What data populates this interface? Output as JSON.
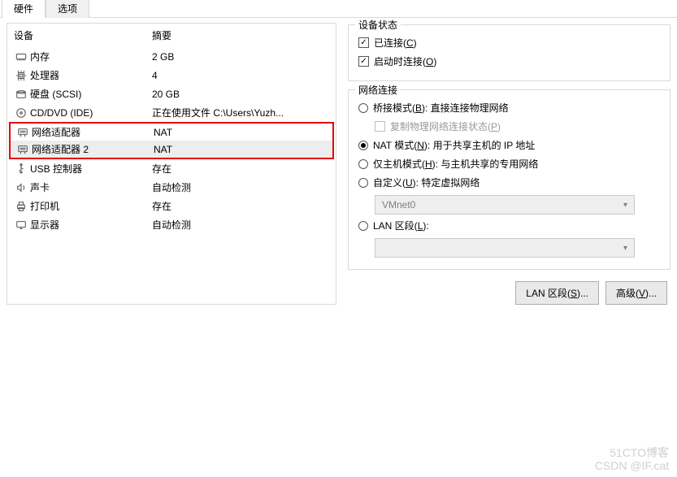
{
  "tabs": {
    "hardware": "硬件",
    "options": "选项"
  },
  "columns": {
    "device": "设备",
    "summary": "摘要"
  },
  "devices": [
    {
      "icon": "memory-icon",
      "name": "内存",
      "summary": "2 GB"
    },
    {
      "icon": "cpu-icon",
      "name": "处理器",
      "summary": "4"
    },
    {
      "icon": "disk-icon",
      "name": "硬盘 (SCSI)",
      "summary": "20 GB"
    },
    {
      "icon": "cd-icon",
      "name": "CD/DVD (IDE)",
      "summary": "正在使用文件 C:\\Users\\Yuzh..."
    },
    {
      "icon": "nic-icon",
      "name": "网络适配器",
      "summary": "NAT"
    },
    {
      "icon": "nic-icon",
      "name": "网络适配器 2",
      "summary": "NAT"
    },
    {
      "icon": "usb-icon",
      "name": "USB 控制器",
      "summary": "存在"
    },
    {
      "icon": "sound-icon",
      "name": "声卡",
      "summary": "自动检测"
    },
    {
      "icon": "printer-icon",
      "name": "打印机",
      "summary": "存在"
    },
    {
      "icon": "display-icon",
      "name": "显示器",
      "summary": "自动检测"
    }
  ],
  "highlight_rows": [
    4,
    5
  ],
  "selected_row": 5,
  "status_group": {
    "title": "设备状态",
    "connected": {
      "label": "已连接(",
      "key": "C",
      "tail": ")",
      "checked": true
    },
    "connect_on": {
      "label": "启动时连接(",
      "key": "O",
      "tail": ")",
      "checked": true
    }
  },
  "net_group": {
    "title": "网络连接",
    "bridge": {
      "label": "桥接模式(",
      "key": "B",
      "tail": "): 直接连接物理网络"
    },
    "bridge_sub": {
      "label": "复制物理网络连接状态(",
      "key": "P",
      "tail": ")"
    },
    "nat": {
      "label": "NAT 模式(",
      "key": "N",
      "tail": "): 用于共享主机的 IP 地址"
    },
    "hostonly": {
      "label": "仅主机模式(",
      "key": "H",
      "tail": "): 与主机共享的专用网络"
    },
    "custom": {
      "label": "自定义(",
      "key": "U",
      "tail": "): 特定虚拟网络"
    },
    "custom_combo": "VMnet0",
    "lan": {
      "label": "LAN 区段(",
      "key": "L",
      "tail": "):"
    },
    "lan_combo": ""
  },
  "buttons": {
    "lan_segments": {
      "label": "LAN 区段(",
      "key": "S",
      "tail": ")..."
    },
    "advanced": {
      "label": "高级(",
      "key": "V",
      "tail": ")..."
    }
  },
  "watermark": {
    "line1": "51CTO博客",
    "line2": "CSDN @IF.cat"
  }
}
